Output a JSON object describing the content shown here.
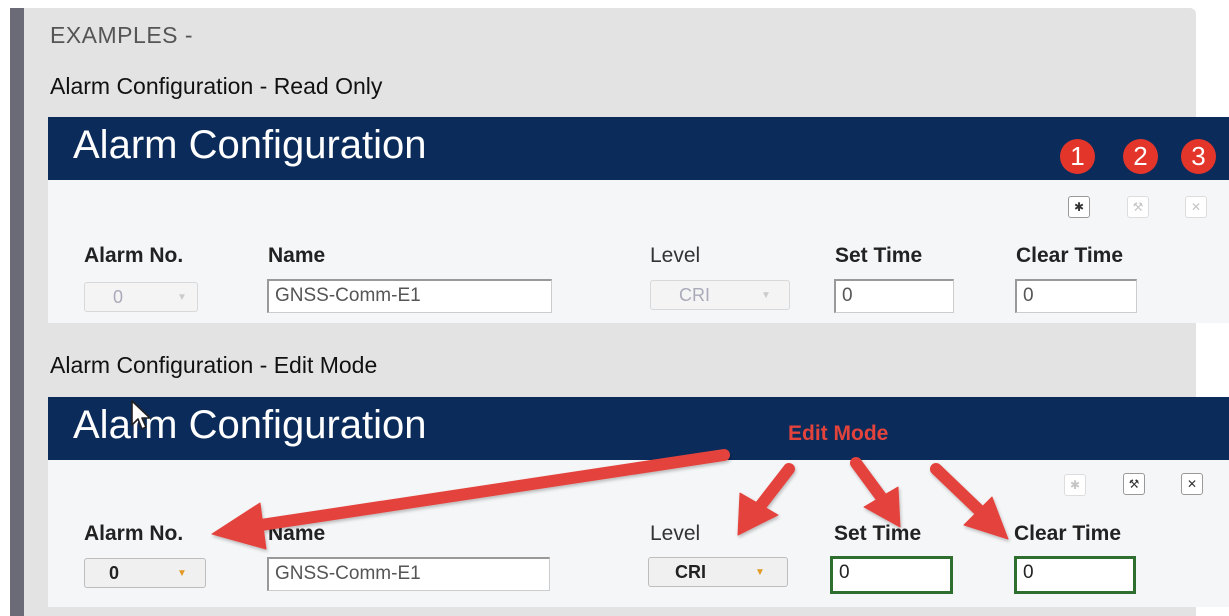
{
  "heading": "EXAMPLES -",
  "readonly": {
    "caption": "Alarm Configuration - Read Only",
    "window_title": "Alarm Configuration",
    "badges": [
      "1",
      "2",
      "3"
    ],
    "icons": {
      "settings": "gear-icon",
      "edit": "wrench-icon",
      "close": "close-icon"
    },
    "fields": {
      "alarm_no_label": "Alarm No.",
      "alarm_no_value": "0",
      "name_label": "Name",
      "name_value": "GNSS-Comm-E1",
      "level_label": "Level",
      "level_value": "CRI",
      "set_time_label": "Set Time",
      "set_time_value": "0",
      "clear_time_label": "Clear Time",
      "clear_time_value": "0"
    }
  },
  "editmode": {
    "caption": "Alarm Configuration - Edit Mode",
    "window_title": "Alarm Configuration",
    "annotation": "Edit Mode",
    "fields": {
      "alarm_no_label": "Alarm No.",
      "alarm_no_value": "0",
      "name_label": "Name",
      "name_value": "GNSS-Comm-E1",
      "level_label": "Level",
      "level_value": "CRI",
      "set_time_label": "Set Time",
      "set_time_value": "0",
      "clear_time_label": "Clear Time",
      "clear_time_value": "0"
    }
  },
  "colors": {
    "header_bg": "#0b2c5b",
    "badge": "#e4352b",
    "arrow": "#e4433c",
    "edit_field_border": "#2e6e2e",
    "dropdown_caret": "#e09a25"
  }
}
